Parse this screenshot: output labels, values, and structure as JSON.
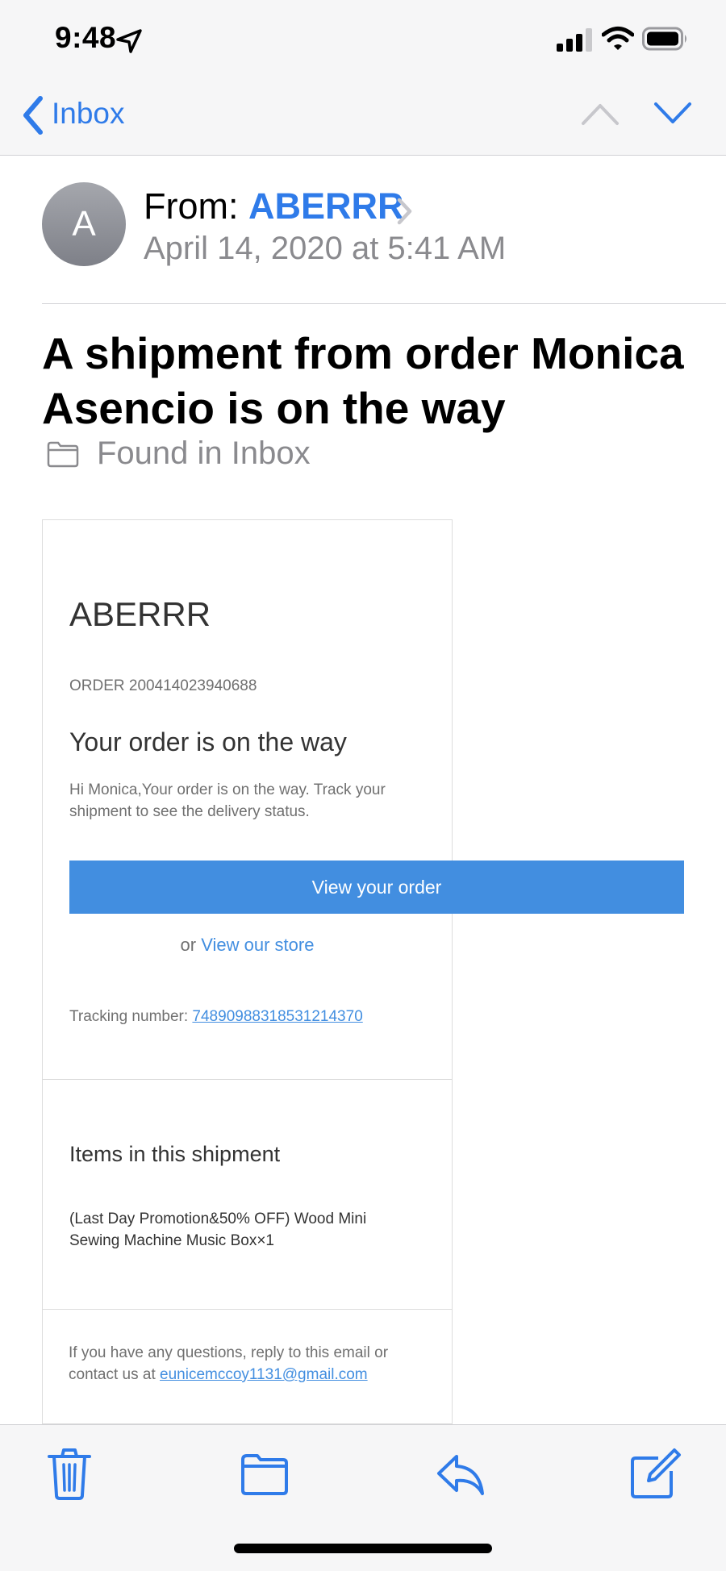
{
  "status_bar": {
    "time": "9:48"
  },
  "nav": {
    "back_label": "Inbox"
  },
  "header": {
    "avatar_initial": "A",
    "from_label": "From:",
    "sender": "ABERRR",
    "date": "April 14, 2020 at 5:41 AM"
  },
  "subject": "A shipment from order Monica Asencio is on the way",
  "found_in": "Found in Inbox",
  "email": {
    "shop_name": "ABERRR",
    "order_number": "ORDER 200414023940688",
    "heading": "Your order is on the way",
    "message": "Hi Monica,Your order is on the way. Track your shipment to see the delivery status.",
    "view_order_button": "View your order",
    "or_label": "or",
    "store_link": "View our store",
    "tracking_label": "Tracking number:",
    "tracking_number": "74890988318531214370",
    "items_heading": "Items in this shipment",
    "items_text": "(Last Day Promotion&50% OFF) Wood Mini Sewing Machine Music Box×1",
    "contact_text": "If you have any questions, reply to this email or contact us at",
    "contact_email": "eunicemccoy1131@gmail.com"
  },
  "toolbar": {
    "icons": [
      "trash-icon",
      "folder-icon",
      "reply-icon",
      "compose-icon"
    ]
  },
  "colors": {
    "accent": "#2f7be9",
    "email_button": "#428ee0",
    "secondary_text": "#8a8a8e"
  }
}
